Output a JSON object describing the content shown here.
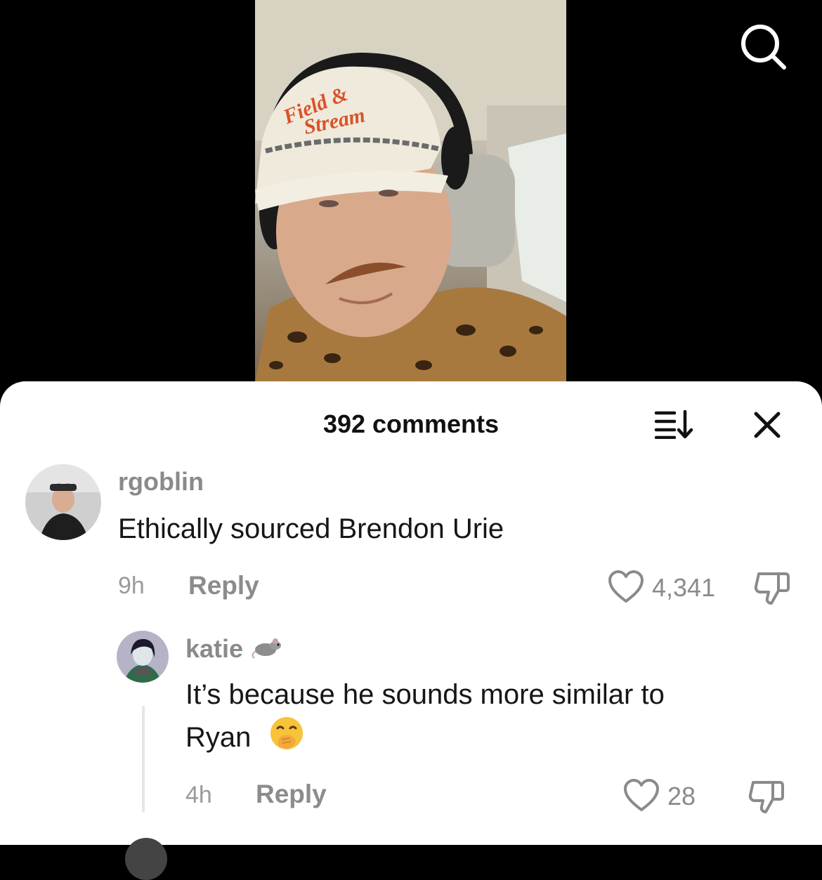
{
  "video": {
    "search_icon": "search-icon"
  },
  "comments_sheet": {
    "title": "392 comments",
    "sort_icon": "sort-icon",
    "close_icon": "close-icon"
  },
  "comments": [
    {
      "username": "rgoblin",
      "text": "Ethically sourced Brendon Urie",
      "time": "9h",
      "reply_label": "Reply",
      "likes": "4,341"
    }
  ],
  "replies": [
    {
      "username": "katie",
      "username_emoji": "rat-emoji",
      "text_line1": "It’s because he sounds more similar to",
      "text_line2": "Ryan",
      "text_emoji": "face-with-hand-over-mouth-emoji",
      "time": "4h",
      "reply_label": "Reply",
      "likes": "28"
    }
  ],
  "colors": {
    "sheet_bg": "#ffffff",
    "meta_gray": "#8a8a8a",
    "text_dark": "#161616"
  }
}
